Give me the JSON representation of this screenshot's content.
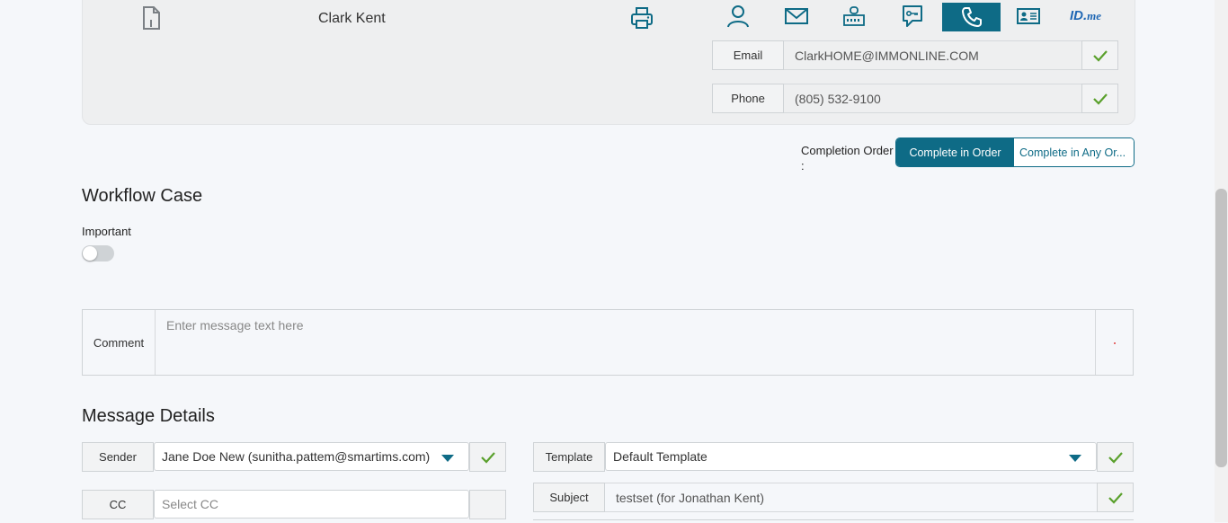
{
  "signer": {
    "name": "Clark Kent",
    "email_label": "Email",
    "email_value": "ClarkHOME@IMMONLINE.COM",
    "phone_label": "Phone",
    "phone_value": "(805) 532-9100",
    "auth_methods": [
      "person-icon",
      "mail-icon",
      "router-icon",
      "chat-key-icon",
      "phone-icon",
      "id-card-icon",
      "id-me-logo"
    ],
    "active_auth": "phone-icon",
    "id_me_main": "ID.",
    "id_me_suffix": "me"
  },
  "completion_order": {
    "label": "Completion Order",
    "colon": ":",
    "options": [
      "Complete in Order",
      "Complete in Any Or..."
    ],
    "selected": "Complete in Order"
  },
  "workflow": {
    "title": "Workflow Case",
    "important_label": "Important",
    "important_on": false
  },
  "comment": {
    "label": "Comment",
    "placeholder": "Enter message text here"
  },
  "message_details": {
    "title": "Message Details",
    "sender_label": "Sender",
    "sender_value": "Jane Doe New (sunitha.pattem@smartims.com)",
    "cc_label": "CC",
    "cc_placeholder": "Select CC",
    "template_label": "Template",
    "template_value": "Default Template",
    "subject_label": "Subject",
    "subject_value": "testset (for Jonathan Kent)"
  },
  "colors": {
    "accent": "#0e6b86",
    "check": "#5aa02c",
    "background": "#f5f7fa"
  }
}
